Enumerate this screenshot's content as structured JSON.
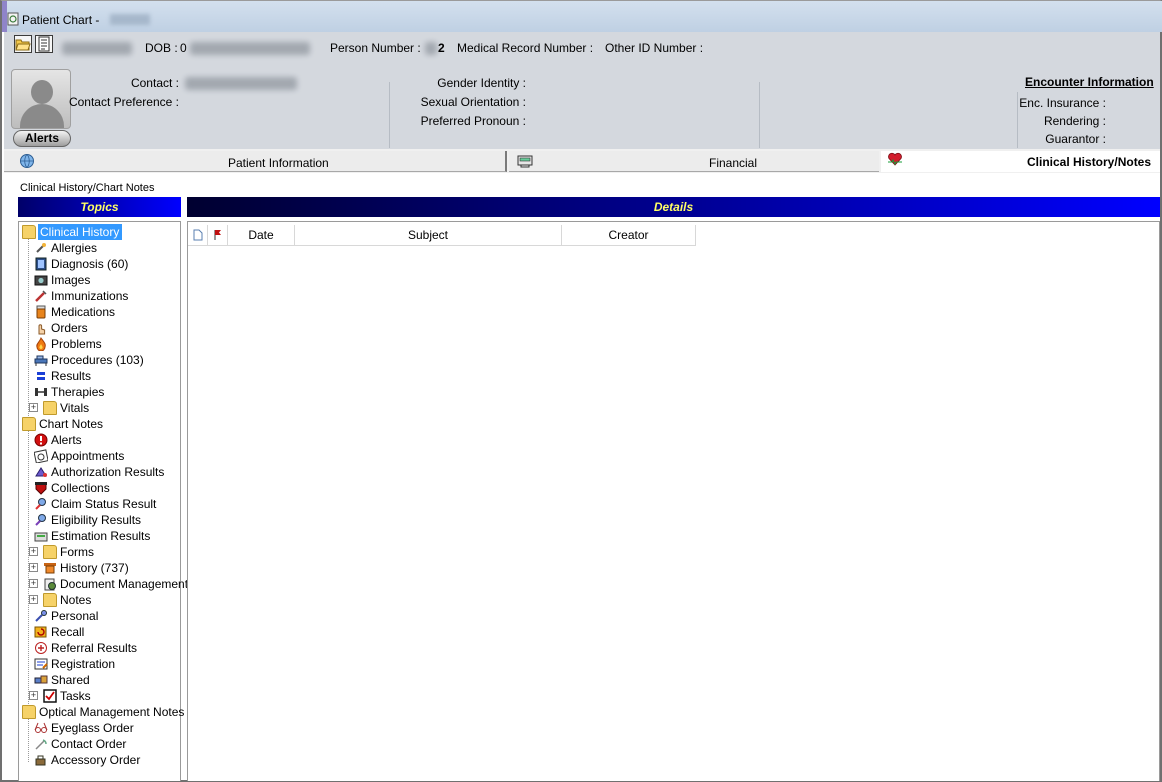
{
  "window": {
    "title": "Patient Chart -"
  },
  "header": {
    "dob_label": "DOB :",
    "dob_value_prefix": "0",
    "person_number_label": "Person Number :",
    "person_number_value": "2",
    "mrn_label": "Medical Record Number :",
    "other_id_label": "Other ID Number :",
    "contact_label": "Contact :",
    "contact_pref_label": "Contact Preference :",
    "gender_identity_label": "Gender Identity :",
    "sexual_orientation_label": "Sexual Orientation :",
    "preferred_pronoun_label": "Preferred Pronoun :",
    "encounter_title": "Encounter Information",
    "enc_insurance_label": "Enc. Insurance :",
    "rendering_label": "Rendering :",
    "guarantor_label": "Guarantor :",
    "alerts_button": "Alerts"
  },
  "tabs": [
    {
      "label": "Patient Information",
      "icon": "globe-icon",
      "active": false
    },
    {
      "label": "Financial",
      "icon": "cash-register-icon",
      "active": false
    },
    {
      "label": "Clinical History/Notes",
      "icon": "heart-icon",
      "active": true
    }
  ],
  "section_label": "Clinical History/Chart Notes",
  "panels": {
    "topics_title": "Topics",
    "details_title": "Details"
  },
  "grid": {
    "columns": [
      "",
      "",
      "Date",
      "Subject",
      "Creator"
    ]
  },
  "tree": {
    "clinical_history": {
      "label": "Clinical History",
      "items": [
        "Allergies",
        "Diagnosis (60)",
        "Images",
        "Immunizations",
        "Medications",
        "Orders",
        "Problems",
        "Procedures (103)",
        "Results",
        "Therapies",
        "Vitals"
      ]
    },
    "chart_notes": {
      "label": "Chart Notes",
      "items": [
        "Alerts",
        "Appointments",
        "Authorization Results",
        "Collections",
        "Claim Status Result",
        "Eligibility Results",
        "Estimation Results",
        "Forms",
        "History (737)",
        "Document Management",
        "Notes",
        "Personal",
        "Recall",
        "Referral Results",
        "Registration",
        "Shared",
        "Tasks"
      ]
    },
    "optical": {
      "label": "Optical Management Notes",
      "items": [
        "Eyeglass Order",
        "Contact Order",
        "Accessory Order"
      ]
    }
  },
  "colors": {
    "selection": "#3399ff",
    "panel_header_text": "#ffff66",
    "panel_header_bg": "#0000ff"
  }
}
